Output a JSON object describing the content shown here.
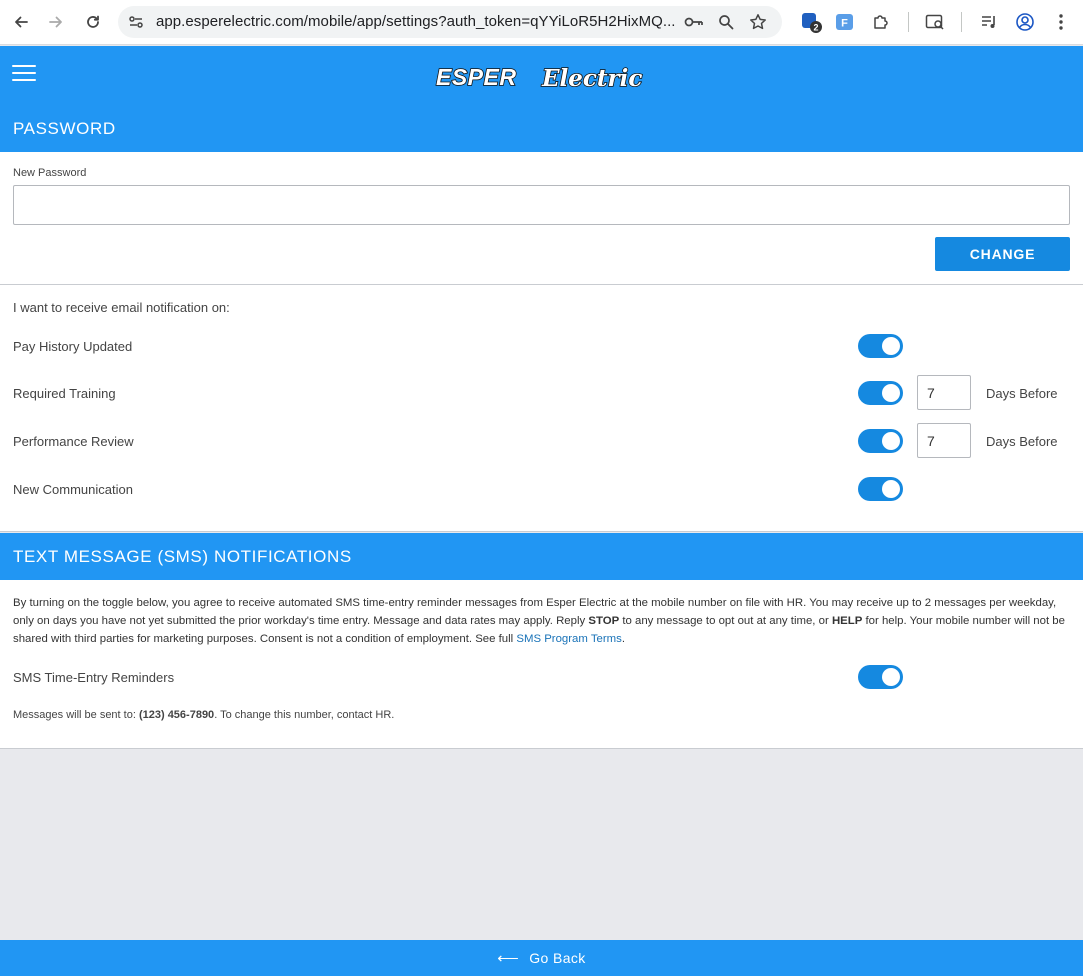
{
  "browser": {
    "url": "app.esperelectric.com/mobile/app/settings?auth_token=qYYiLoR5H2HixMQ...",
    "ext_badge": "2",
    "ext_label": "F"
  },
  "header": {
    "logo_part1": "ESPER",
    "logo_part2": "Electric"
  },
  "password": {
    "section_title": "PASSWORD",
    "field_label": "New Password",
    "field_value": "",
    "change_label": "CHANGE"
  },
  "email_notifications": {
    "intro": "I want to receive email notification on:",
    "items": [
      {
        "label": "Pay History Updated",
        "enabled": true
      },
      {
        "label": "Required Training",
        "enabled": true,
        "days": "7",
        "days_label": "Days Before"
      },
      {
        "label": "Performance Review",
        "enabled": true,
        "days": "7",
        "days_label": "Days Before"
      },
      {
        "label": "New Communication",
        "enabled": true
      }
    ]
  },
  "sms": {
    "section_title": "TEXT MESSAGE (SMS) NOTIFICATIONS",
    "disclaimer_1": "By turning on the toggle below, you agree to receive automated SMS time-entry reminder messages from Esper Electric at the mobile number on file with HR. You may receive up to 2 messages per weekday, only on days you have not yet submitted the prior workday's time entry. Message and data rates may apply. Reply ",
    "stop": "STOP",
    "disclaimer_2": " to any message to opt out at any time, or ",
    "help": "HELP",
    "disclaimer_3": " for help. Your mobile number will not be shared with third parties for marketing purposes. Consent is not a condition of employment. See full ",
    "terms_link": "SMS Program Terms",
    "period": ".",
    "toggle_label": "SMS Time-Entry Reminders",
    "enabled": true,
    "note_prefix": "Messages will be sent to: ",
    "phone": "(123) 456-7890",
    "note_suffix": ". To change this number, contact HR."
  },
  "footer": {
    "arrow": "⟵",
    "go_back": "Go Back"
  },
  "colors": {
    "brand_blue": "#2196f3",
    "button_blue": "#1589e0",
    "page_bg": "#e8e9ed"
  }
}
